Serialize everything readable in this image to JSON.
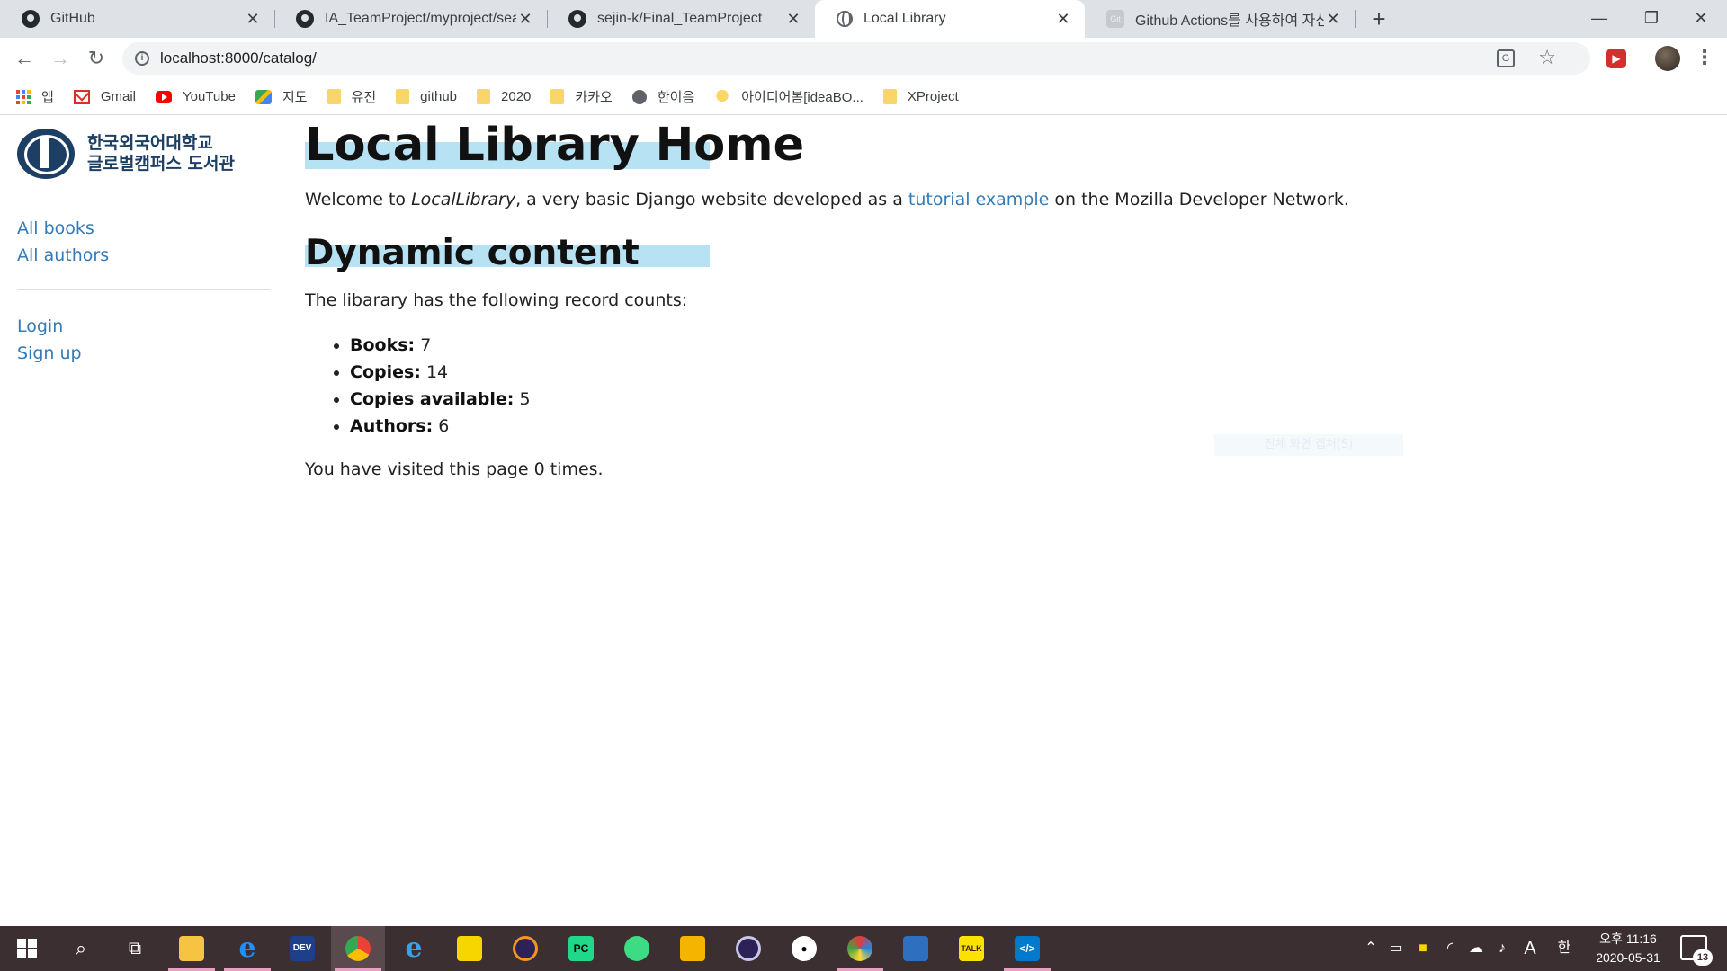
{
  "browser": {
    "tabs": [
      {
        "title": "GitHub",
        "icon": "github-icon"
      },
      {
        "title": "IA_TeamProject/myproject/search",
        "icon": "github-icon"
      },
      {
        "title": "sejin-k/Final_TeamProject",
        "icon": "github-icon"
      },
      {
        "title": "Local Library",
        "icon": "globe-icon",
        "active": true
      },
      {
        "title": "Github Actions를 사용하여 자신",
        "icon": "page-icon",
        "favicon_text": "Git"
      }
    ],
    "new_tab_label": "+",
    "window_controls": {
      "minimize": "—",
      "maximize": "❐",
      "close": "✕"
    },
    "url": "localhost:8000/catalog/",
    "bookmarks": [
      {
        "label": "앱",
        "icon": "apps-icon"
      },
      {
        "label": "Gmail",
        "icon": "gmail-icon"
      },
      {
        "label": "YouTube",
        "icon": "youtube-icon"
      },
      {
        "label": "지도",
        "icon": "maps-icon"
      },
      {
        "label": "유진",
        "icon": "folder-icon"
      },
      {
        "label": "github",
        "icon": "folder-icon"
      },
      {
        "label": "2020",
        "icon": "folder-icon"
      },
      {
        "label": "카카오",
        "icon": "folder-icon"
      },
      {
        "label": "한이음",
        "icon": "globe-icon"
      },
      {
        "label": "아이디어봄[ideaBO...",
        "icon": "lightbulb-icon"
      },
      {
        "label": "XProject",
        "icon": "folder-icon"
      }
    ]
  },
  "sidebar": {
    "logo_line1": "한국외국어대학교",
    "logo_line2": "글로벌캠퍼스 도서관",
    "links": [
      "All books",
      "All authors"
    ],
    "auth_links": [
      "Login",
      "Sign up"
    ]
  },
  "content": {
    "title": "Local Library Home",
    "welcome_prefix": "Welcome to ",
    "welcome_site": "LocalLibrary",
    "welcome_middle": ", a very basic Django website developed as a ",
    "welcome_link": "tutorial example",
    "welcome_suffix": " on the Mozilla Developer Network.",
    "dynamic_heading": "Dynamic content",
    "counts_intro": "The libarary has the following record counts:",
    "stats": [
      {
        "label": "Books:",
        "value": "7"
      },
      {
        "label": "Copies:",
        "value": "14"
      },
      {
        "label": "Copies available:",
        "value": "5"
      },
      {
        "label": "Authors:",
        "value": "6"
      }
    ],
    "visits_text": "You have visited this page 0 times.",
    "ghost_text": "전체 화면 캡처(S)"
  },
  "taskbar": {
    "apps": [
      "start-button",
      "search-icon",
      "task-view-icon",
      "file-explorer-icon",
      "edge-icon",
      "devcpp-icon",
      "chrome-icon",
      "ie-icon",
      "sticky-notes-icon",
      "eclipse-icon",
      "pycharm-icon",
      "android-studio-icon",
      "maze-app-icon",
      "eclipse2-icon",
      "penguin-app-icon",
      "paint-icon",
      "network-icon",
      "kakaotalk-icon",
      "vscode-icon"
    ],
    "ime_label": "A",
    "lang_label": "한",
    "clock_time": "오후 11:16",
    "clock_date": "2020-05-31",
    "notifications": "13",
    "colors": {
      "taskbar": "#3b2f31",
      "running_indicator": "#e8a0c0"
    }
  }
}
